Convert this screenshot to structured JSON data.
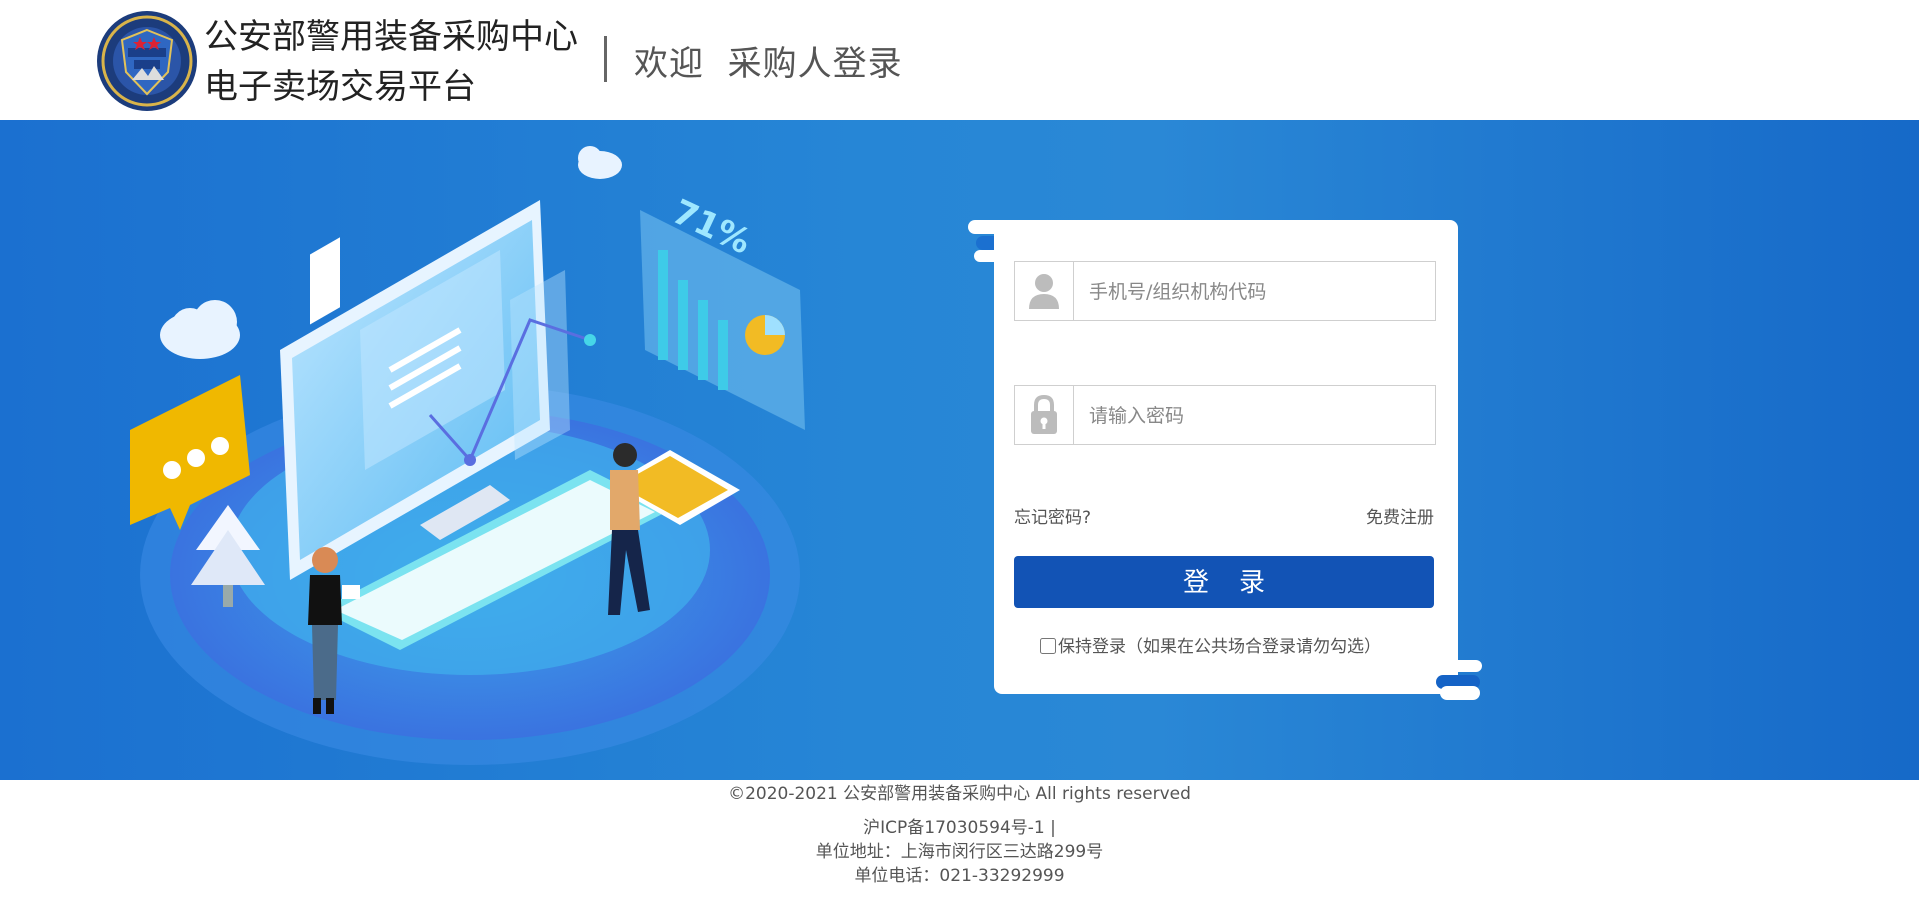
{
  "header": {
    "title_line1": "公安部警用装备采购中心",
    "title_line2": "电子卖场交易平台",
    "welcome": "欢迎",
    "page_name": "采购人登录"
  },
  "illustration": {
    "percent_label": "71%"
  },
  "login": {
    "username_placeholder": "手机号/组织机构代码",
    "password_placeholder": "请输入密码",
    "forgot_label": "忘记密码?",
    "register_label": "免费注册",
    "login_button": "登录",
    "keep_label": "保持登录",
    "keep_hint": "（如果在公共场合登录请勿勾选）",
    "user_icon": "user-icon",
    "lock_icon": "lock-icon"
  },
  "footer": {
    "copyright": "©2020-2021 公安部警用装备采购中心 All rights reserved",
    "icp": "沪ICP备17030594号-1 |",
    "address": "单位地址：上海市闵行区三达路299号",
    "phone": "单位电话：021-33292999"
  },
  "colors": {
    "primary": "#1253b5",
    "banner": "#1b70d0"
  }
}
